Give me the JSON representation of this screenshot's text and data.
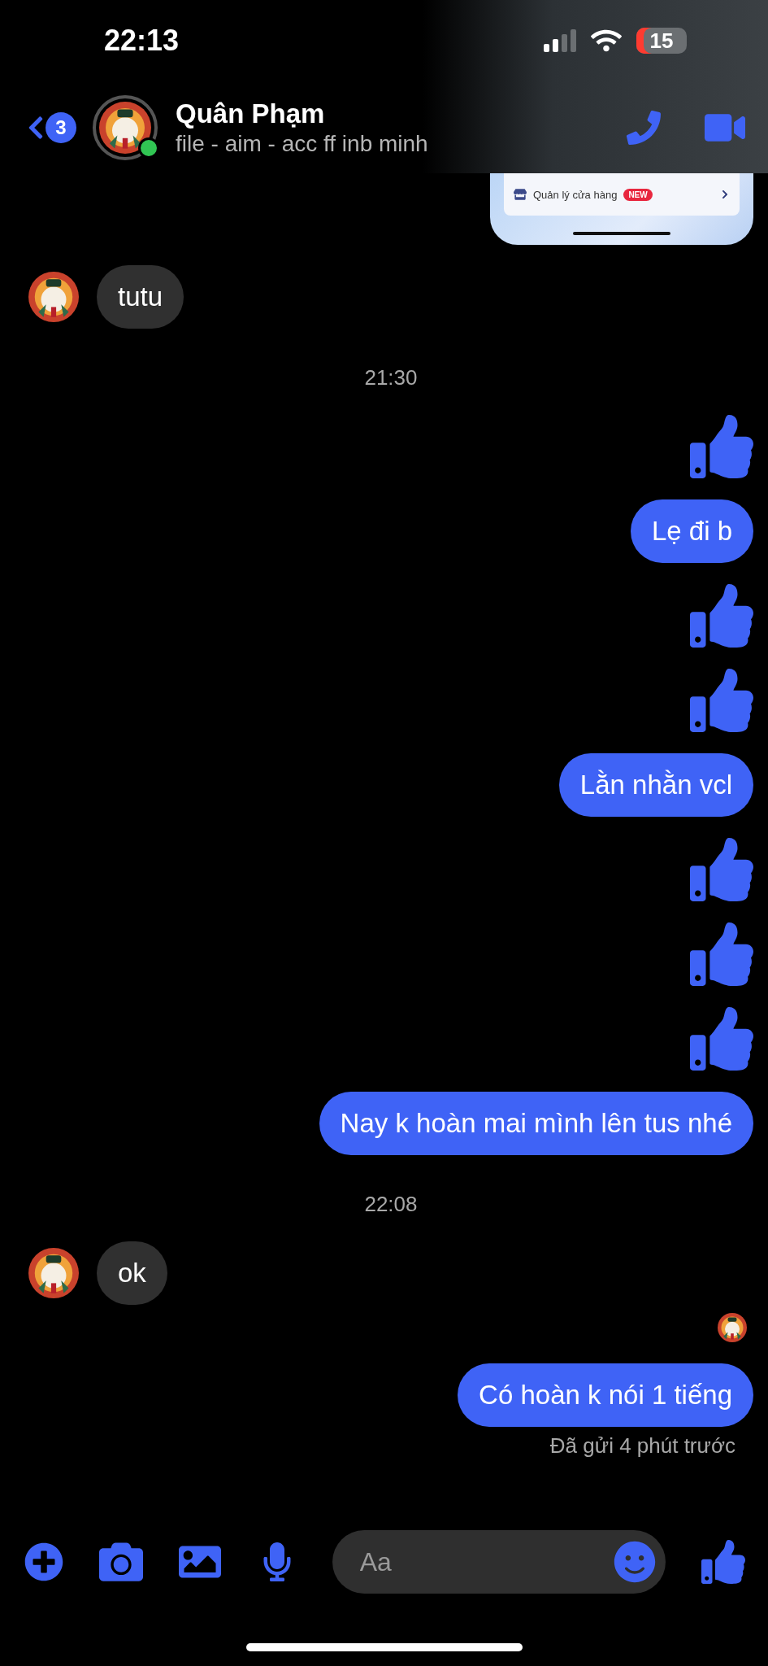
{
  "status_bar": {
    "time": "22:13",
    "battery": "15"
  },
  "header": {
    "back_badge": "3",
    "name": "Quân Phạm",
    "subtitle": "file - aim - acc ff inb minh",
    "online": true
  },
  "shared_image": {
    "row_label": "Quản lý cửa hàng",
    "badge": "NEW"
  },
  "messages": [
    {
      "kind": "text",
      "outgoing": false,
      "text": "tutu"
    },
    {
      "kind": "time",
      "text": "21:30"
    },
    {
      "kind": "like",
      "outgoing": true
    },
    {
      "kind": "text",
      "outgoing": true,
      "text": "Lẹ đi b"
    },
    {
      "kind": "like",
      "outgoing": true
    },
    {
      "kind": "like",
      "outgoing": true
    },
    {
      "kind": "text",
      "outgoing": true,
      "text": "Lằn nhằn vcl"
    },
    {
      "kind": "like",
      "outgoing": true
    },
    {
      "kind": "like",
      "outgoing": true
    },
    {
      "kind": "like",
      "outgoing": true
    },
    {
      "kind": "text",
      "outgoing": true,
      "text": "Nay k hoàn mai mình lên tus nhé"
    },
    {
      "kind": "time",
      "text": "22:08"
    },
    {
      "kind": "text",
      "outgoing": false,
      "text": "ok"
    },
    {
      "kind": "seen"
    },
    {
      "kind": "text",
      "outgoing": true,
      "text": "Có hoàn k nói 1 tiếng"
    },
    {
      "kind": "note",
      "text": "Đã gửi 4 phút trước"
    }
  ],
  "composer": {
    "placeholder": "Aa"
  }
}
